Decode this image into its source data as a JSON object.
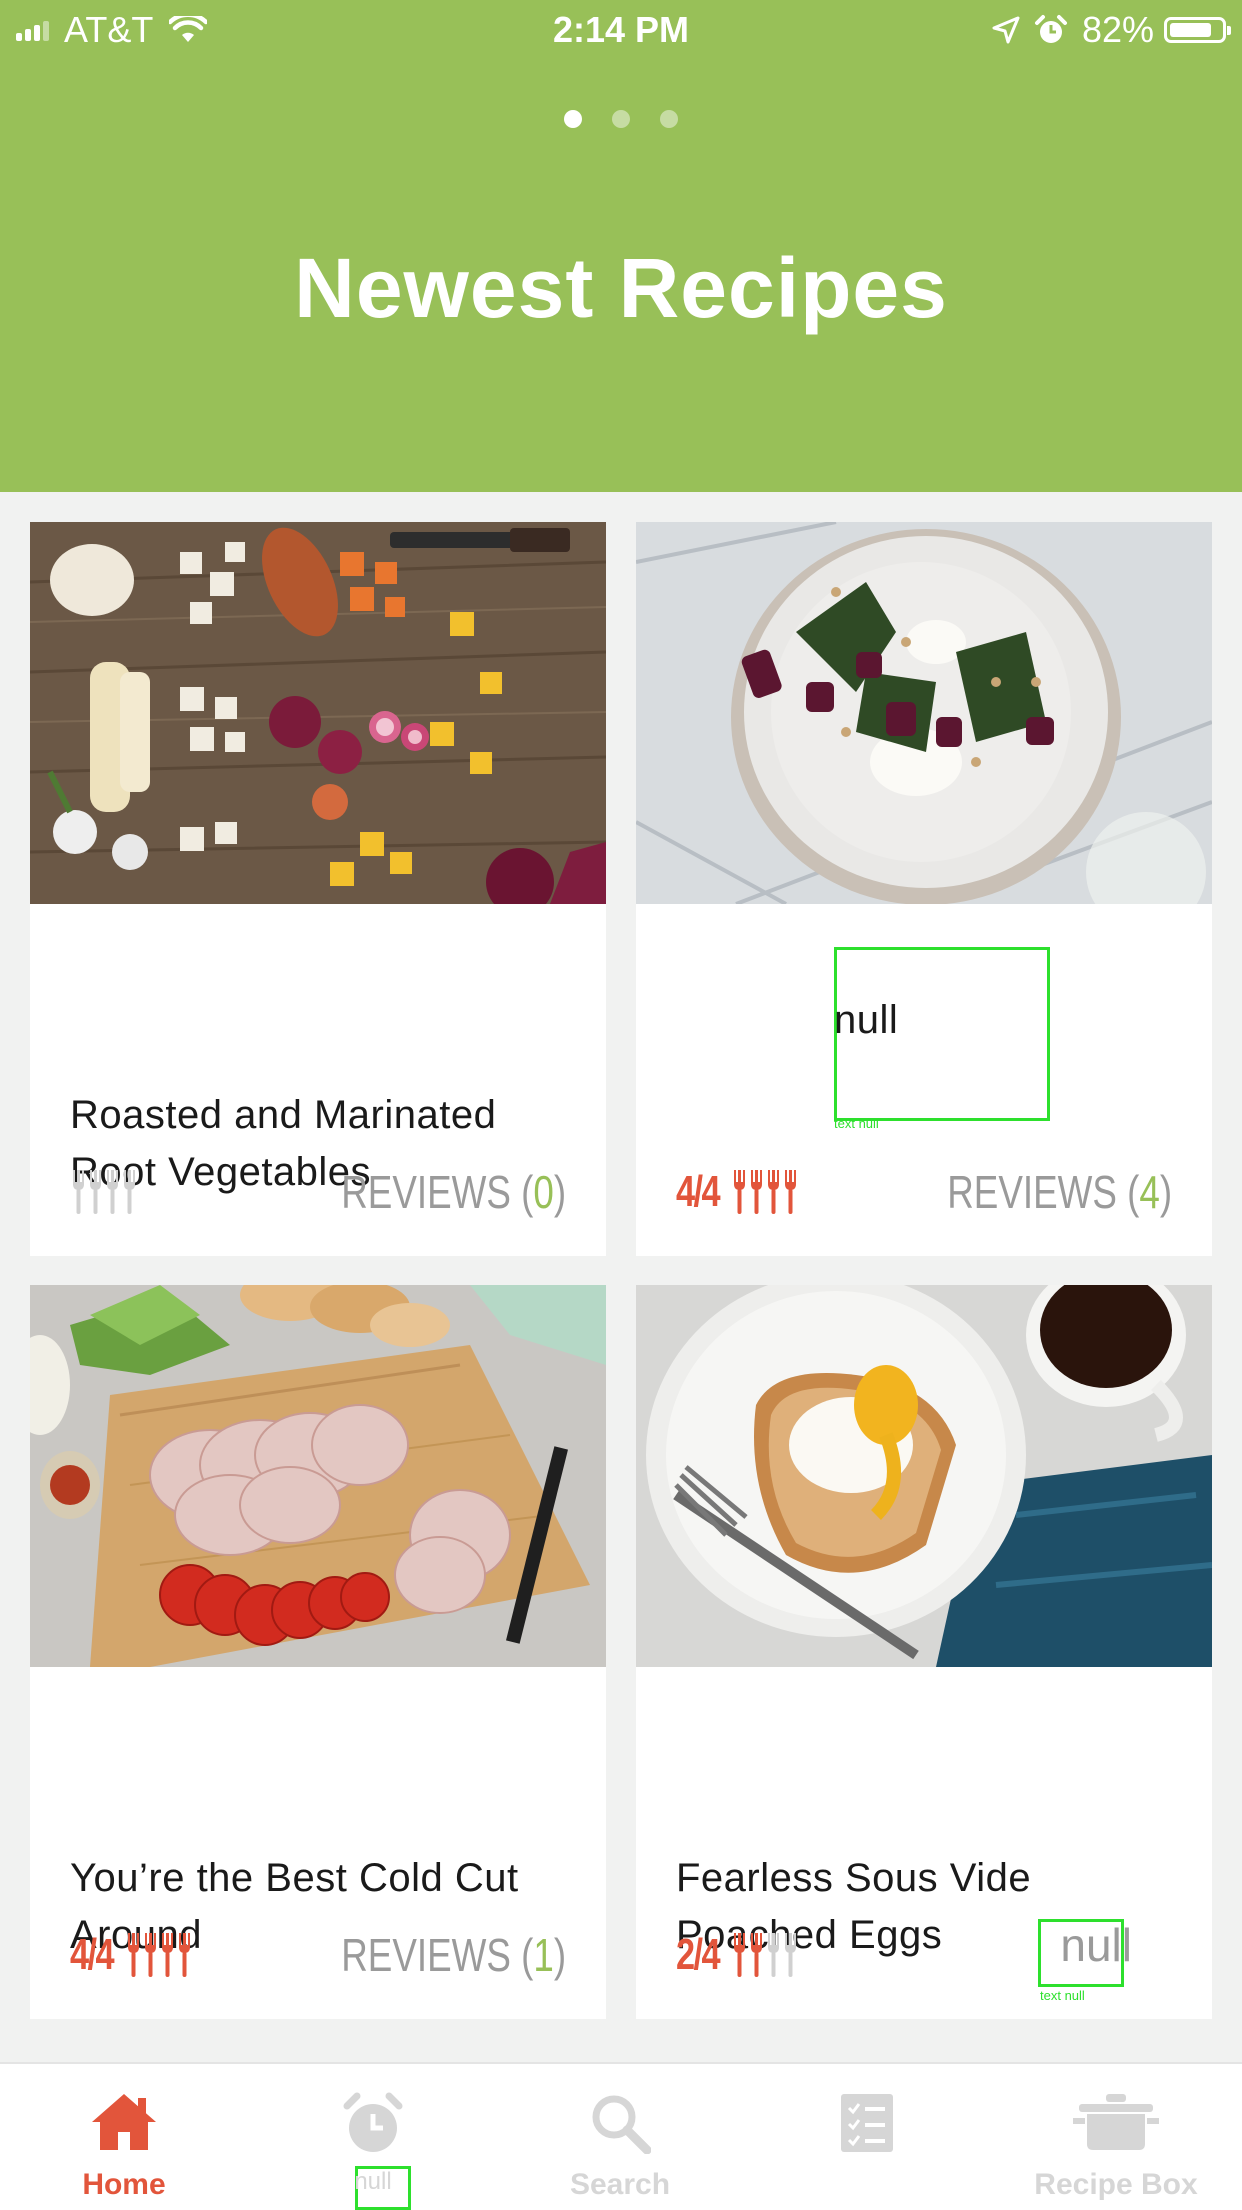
{
  "status_bar": {
    "carrier": "AT&T",
    "time": "2:14 PM",
    "battery_pct": "82%",
    "battery_level": 0.82,
    "signal_bars": 3,
    "icons": [
      "wifi-icon",
      "location-arrow-icon",
      "alarm-icon",
      "battery-icon"
    ]
  },
  "header": {
    "title": "Newest Recipes",
    "page_dots": 3,
    "active_dot": 0,
    "background": "#98c058"
  },
  "colors": {
    "accent_red": "#e2553b",
    "accent_green": "#98c058",
    "muted_gray": "#9a9a9a"
  },
  "recipes": [
    {
      "title": "Roasted and Marinated Root Vegetables",
      "rating_text": "",
      "rating": 0,
      "rating_max": 4,
      "reviews_label": "REVIEWS (",
      "reviews_count": "0",
      "reviews_close": ")"
    },
    {
      "title": "null",
      "null_caption": "text null",
      "rating_text": "4/4",
      "rating": 4,
      "rating_max": 4,
      "reviews_label": "REVIEWS (",
      "reviews_count": "4",
      "reviews_close": ")"
    },
    {
      "title": "You’re the Best Cold Cut Around",
      "rating_text": "4/4",
      "rating": 4,
      "rating_max": 4,
      "reviews_label": "REVIEWS (",
      "reviews_count": "1",
      "reviews_close": ")"
    },
    {
      "title": "Fearless Sous Vide Poached Eggs",
      "rating_text": "2/4",
      "rating": 2,
      "rating_max": 4,
      "reviews_text": "null",
      "null_caption": "text null"
    }
  ],
  "tabbar": {
    "tabs": [
      {
        "label": "Home",
        "icon": "home-icon",
        "active": true
      },
      {
        "label": "null",
        "icon": "alarm-clock-icon",
        "active": false
      },
      {
        "label": "Search",
        "icon": "search-icon",
        "active": false
      },
      {
        "label": "",
        "icon": "checklist-icon",
        "active": false
      },
      {
        "label": "Recipe Box",
        "icon": "pot-icon",
        "active": false
      }
    ]
  }
}
